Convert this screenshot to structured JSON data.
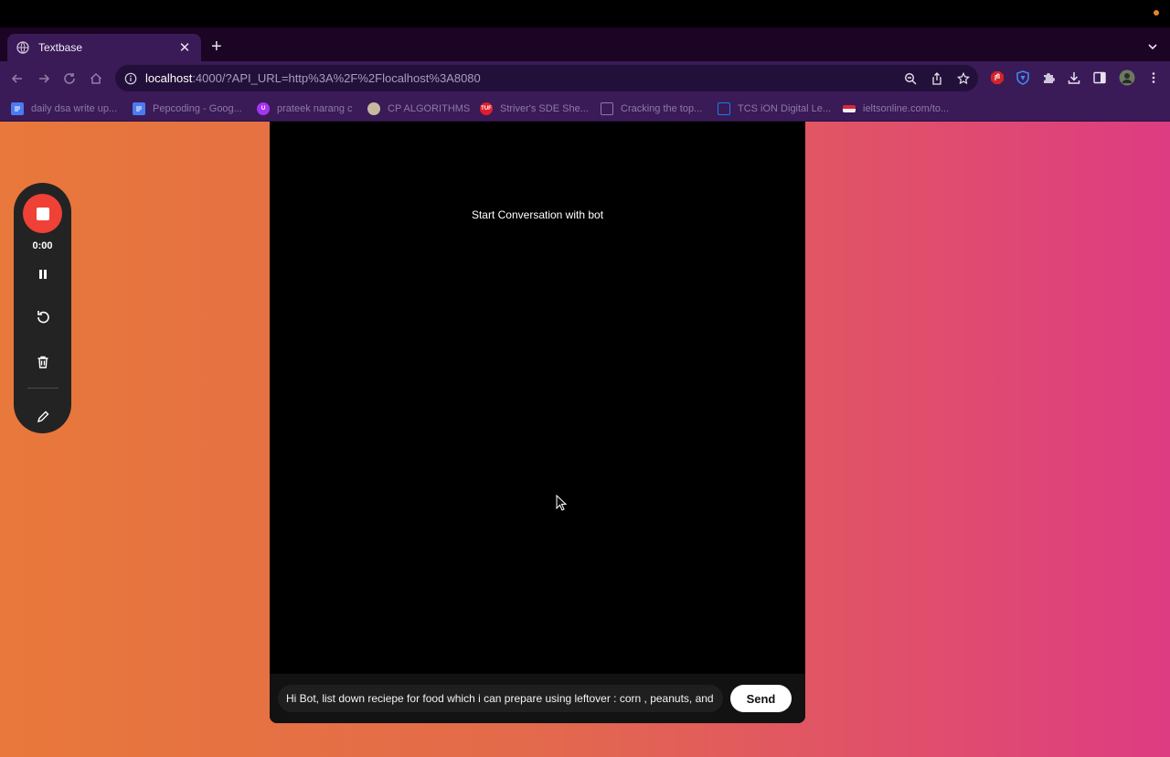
{
  "browser": {
    "tab": {
      "title": "Textbase",
      "icon": "globe-icon"
    },
    "address": {
      "host": "localhost",
      "path": ":4000/?API_URL=http%3A%2F%2Flocalhost%3A8080"
    },
    "bookmarks": [
      {
        "label": "daily dsa write up...",
        "icon": "docs-icon",
        "color": "#4a7bf0"
      },
      {
        "label": "Pepcoding - Goog...",
        "icon": "docs-icon",
        "color": "#4a7bf0"
      },
      {
        "label": "prateek narang c",
        "icon": "udemy-icon",
        "color": "#a435f0"
      },
      {
        "label": "CP ALGORITHMS",
        "icon": "cp-algorithms-icon",
        "color": "#c7b9a0"
      },
      {
        "label": "Striver's SDE She...",
        "icon": "tuf-icon",
        "color": "#e01e2b"
      },
      {
        "label": "Cracking the top...",
        "icon": "page-icon",
        "color": "#3a1a57"
      },
      {
        "label": "TCS iON Digital Le...",
        "icon": "tcs-icon",
        "color": "#1a7fe0"
      },
      {
        "label": "ieltsonline.com/to...",
        "icon": "ielts-icon",
        "color": "#d9273b"
      }
    ]
  },
  "chat": {
    "empty_message": "Start Conversation with bot",
    "input_value": "Hi Bot, list down reciepe for food which i can prepare using leftover : corn , peanuts, and",
    "send_label": "Send"
  },
  "recorder": {
    "time": "0:00"
  },
  "colors": {
    "accent_record": "#ef4136",
    "gradient_start": "#e8783b",
    "gradient_end": "#de3c82"
  }
}
